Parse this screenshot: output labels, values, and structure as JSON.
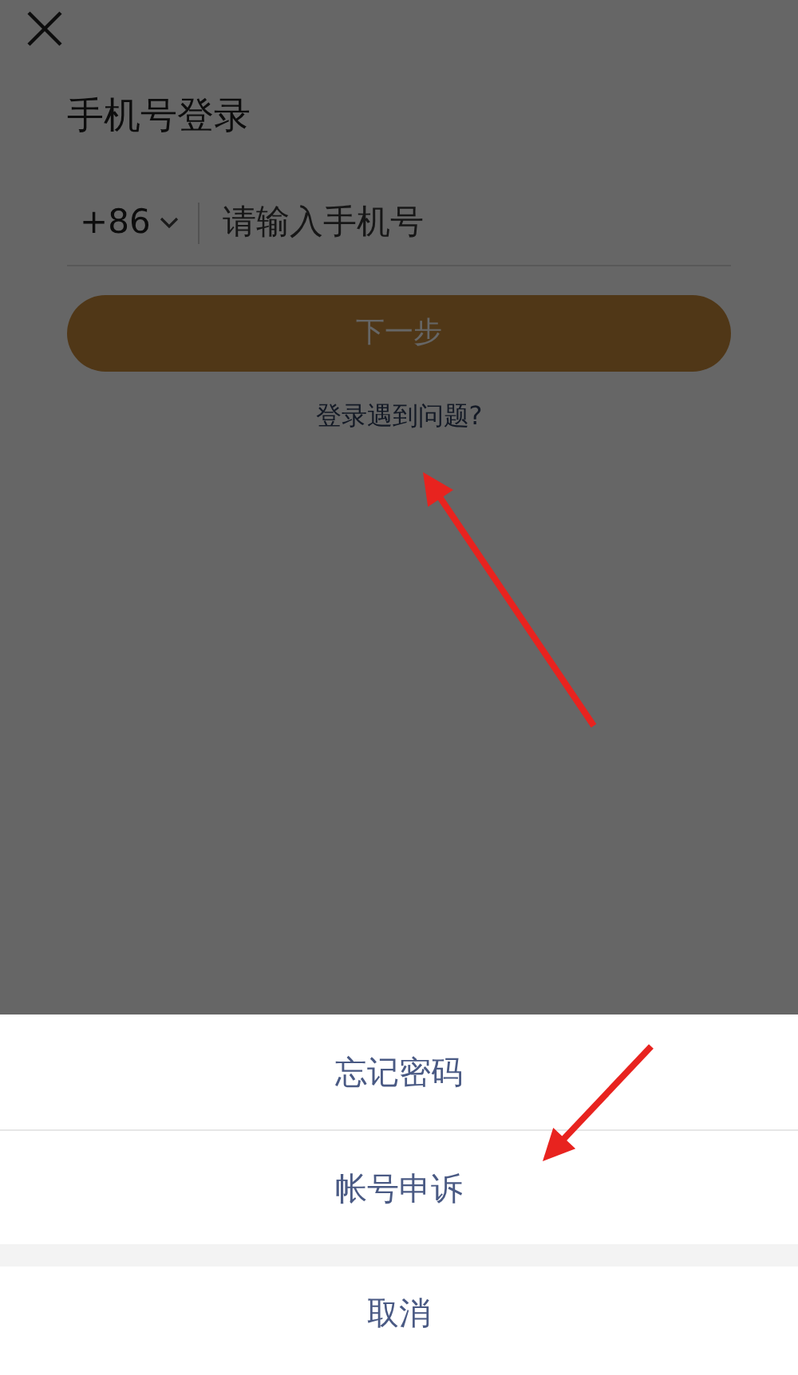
{
  "login": {
    "title": "手机号登录",
    "country_code": "+86",
    "phone_field": {
      "placeholder": "请输入手机号"
    },
    "next_button": {
      "label": "下一步",
      "disabled": true
    },
    "help_link": "登录遇到问题?"
  },
  "dimmed": true,
  "action_sheet": {
    "items": [
      "忘记密码",
      "帐号申诉"
    ],
    "cancel": "取消"
  },
  "annotations": [
    {
      "kind": "arrow"
    },
    {
      "kind": "arrow"
    }
  ]
}
